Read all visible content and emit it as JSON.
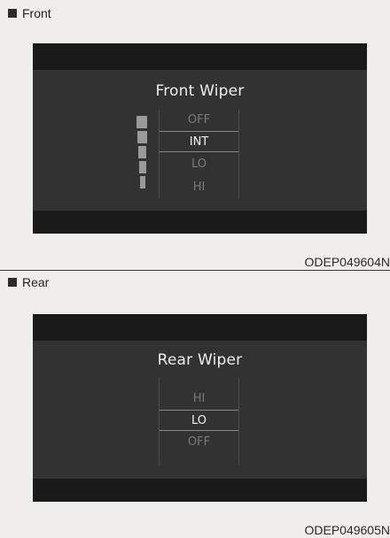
{
  "front": {
    "section_label": "Front",
    "title": "Front Wiper",
    "options": [
      "OFF",
      "INT",
      "LO",
      "HI"
    ],
    "selected": "INT",
    "caption": "ODEP049604N"
  },
  "rear": {
    "section_label": "Rear",
    "title": "Rear Wiper",
    "options": [
      "HI",
      "LO",
      "OFF"
    ],
    "selected": "LO",
    "caption": "ODEP049605N"
  }
}
